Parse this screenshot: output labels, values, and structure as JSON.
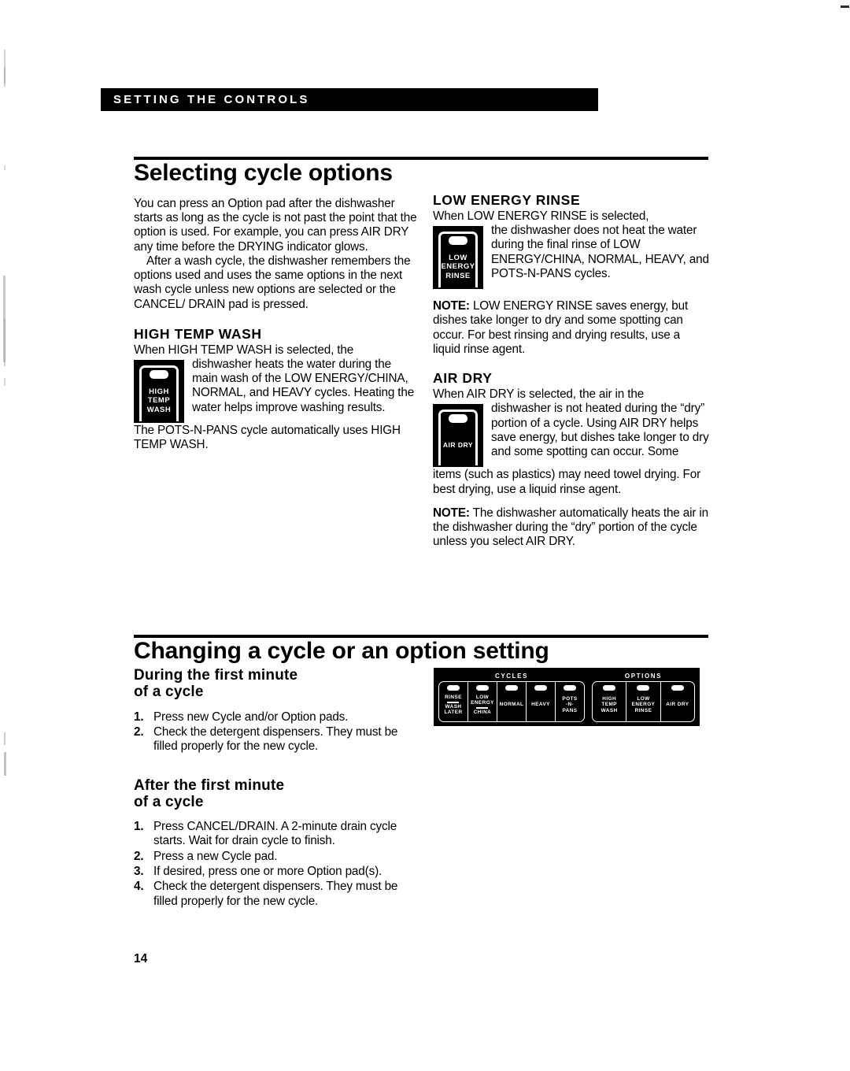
{
  "banner": {
    "running_head": "SETTING THE CONTROLS"
  },
  "folio": {
    "page_number": "14"
  },
  "section_one": {
    "title": "Selecting cycle options",
    "intro_p1": "You can press an Option pad after the dishwasher starts as long as the cycle is not past the point that the option is used. For example, you can press AIR DRY any time before the DRYING indicator glows.",
    "intro_p2": "After a wash cycle, the dishwasher remembers the options used and uses the same options in the next wash cycle unless new options are selected or the CANCEL/ DRAIN pad is pressed.",
    "high_temp_wash": {
      "heading": "HIGH TEMP WASH",
      "lead": "When HIGH TEMP WASH is selected, the",
      "wrap": "dishwasher heats the water during the main wash of the LOW ENERGY/CHINA, NORMAL, and HEAVY cycles. Heating the water helps improve washing results.",
      "tail": "The POTS-N-PANS cycle automatically uses HIGH TEMP WASH.",
      "pad_label_lines": [
        "HIGH",
        "TEMP",
        "WASH"
      ]
    },
    "low_energy_rinse": {
      "heading": "LOW ENERGY RINSE",
      "lead": "When LOW ENERGY RINSE is selected,",
      "wrap": "the dishwasher does not heat the water during the final rinse of LOW ENERGY/CHINA, NORMAL, HEAVY, and POTS-N-PANS cycles.",
      "note_label": "NOTE:",
      "note_text": " LOW ENERGY RINSE saves energy, but dishes take longer to dry and some spotting can occur. For best rinsing and drying results, use a liquid rinse agent.",
      "pad_label_lines": [
        "LOW",
        "ENERGY",
        "RINSE"
      ]
    },
    "air_dry": {
      "heading": "AIR DRY",
      "lead": "When AIR DRY is selected, the air in the",
      "wrap": "dishwasher is not heated during the “dry” portion of a cycle. Using AIR DRY helps save energy, but dishes take longer to dry and some spotting can occur. Some",
      "tail": "items (such as plastics) may need towel drying. For best drying, use a liquid rinse agent.",
      "note_label": "NOTE:",
      "note_text": " The dishwasher automatically heats the air in the dishwasher during the “dry” portion of the cycle unless you select AIR DRY.",
      "pad_label_lines": [
        "AIR DRY"
      ]
    }
  },
  "section_two": {
    "title": "Changing a cycle or an option setting",
    "during_first_minute": {
      "heading_line1": "During the first minute",
      "heading_line2": "of a cycle",
      "steps": [
        {
          "num": "1.",
          "text": "Press new Cycle and/or Option pads."
        },
        {
          "num": "2.",
          "text": "Check the detergent dispensers. They must be filled properly for the new cycle."
        }
      ]
    },
    "after_first_minute": {
      "heading_line1": "After the first minute",
      "heading_line2": "of a cycle",
      "steps": [
        {
          "num": "1.",
          "text": "Press CANCEL/DRAIN. A 2-minute drain cycle starts. Wait for drain cycle to finish."
        },
        {
          "num": "2.",
          "text": "Press a new Cycle pad."
        },
        {
          "num": "3.",
          "text": "If desired, press one or more Option pad(s)."
        },
        {
          "num": "4.",
          "text": "Check the detergent dispensers. They must be filled properly for the new cycle."
        }
      ]
    }
  },
  "console_diagram": {
    "groups": [
      {
        "title": "CYCLES",
        "pads": [
          {
            "lines": [
              "RINSE",
              "divider",
              "WASH",
              "LATER"
            ]
          },
          {
            "lines": [
              "LOW",
              "ENERGY",
              "divider",
              "CHINA"
            ]
          },
          {
            "lines": [
              "NORMAL"
            ]
          },
          {
            "lines": [
              "HEAVY"
            ]
          },
          {
            "lines": [
              "POTS",
              "-N-",
              "PANS"
            ]
          }
        ]
      },
      {
        "title": "OPTIONS",
        "pads": [
          {
            "lines": [
              "HIGH",
              "TEMP",
              "WASH"
            ]
          },
          {
            "lines": [
              "LOW",
              "ENERGY",
              "RINSE"
            ]
          },
          {
            "lines": [
              "AIR DRY"
            ]
          }
        ]
      }
    ]
  }
}
